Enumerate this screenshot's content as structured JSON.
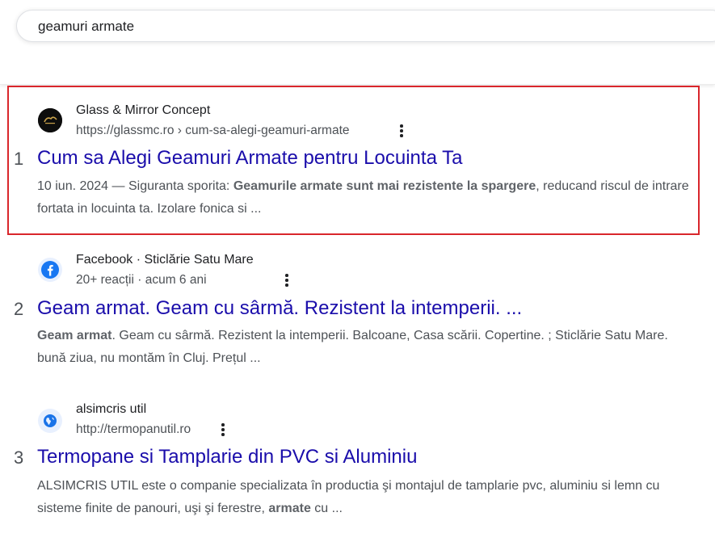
{
  "search": {
    "query": "geamuri armate"
  },
  "results": [
    {
      "rank": "1",
      "site_name": "Glass & Mirror Concept",
      "url": "https://glassmc.ro › cum-sa-alegi-geamuri-armate",
      "title": "Cum sa Alegi Geamuri Armate pentru Locuinta Ta",
      "snippet_date": "10 iun. 2024 — ",
      "snippet_a": "Siguranta sporita: ",
      "snippet_bold": "Geamurile armate sunt mai rezistente la spargere",
      "snippet_b": ", reducand riscul de intrare fortata in locuinta ta. Izolare fonica si ..."
    },
    {
      "rank": "2",
      "site_name": "Facebook · Sticlărie Satu Mare",
      "url": "20+ reacții · acum 6 ani",
      "title": "Geam armat. Geam cu sârmă. Rezistent la intemperii. ...",
      "snippet_bold": "Geam armat",
      "snippet_b": ". Geam cu sârmă. Rezistent la intemperii. Balcoane, Casa scării. Copertine. ; Sticlărie Satu Mare. bună ziua, nu montăm în Cluj. Prețul ..."
    },
    {
      "rank": "3",
      "site_name": "alsimcris util",
      "url": "http://termopanutil.ro",
      "title": "Termopane si Tamplarie din PVC si Aluminiu",
      "snippet_a": "ALSIMCRIS UTIL este o companie specializata în productia şi montajul de tamplarie pvc, aluminiu si lemn cu sisteme finite de panouri, uşi şi ferestre, ",
      "snippet_bold": "armate",
      "snippet_b": " cu ..."
    }
  ],
  "colors": {
    "link": "#1a0dab",
    "highlight": "#d9262b",
    "facebook": "#1877f2",
    "globe": "#1a73e8"
  }
}
